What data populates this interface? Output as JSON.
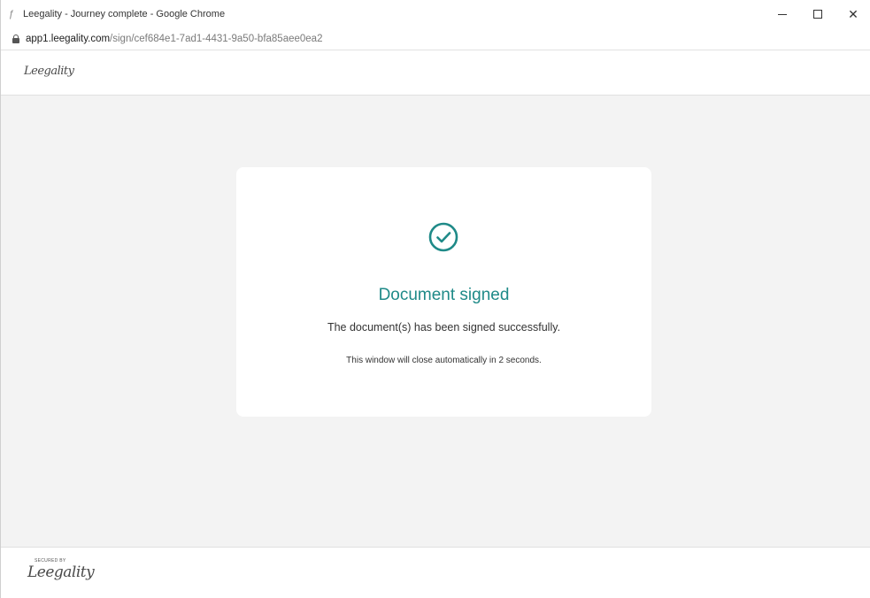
{
  "window": {
    "title": "Leegality - Journey complete - Google Chrome"
  },
  "address_bar": {
    "host": "app1.leegality.com",
    "path": "/sign/cef684e1-7ad1-4431-9a50-bfa85aee0ea2"
  },
  "header": {
    "logo_text": "Leegality"
  },
  "card": {
    "icon": "check-circle-icon",
    "title": "Document signed",
    "message": "The document(s) has been signed successfully.",
    "note": "This window will close automatically in 2 seconds."
  },
  "footer": {
    "secured_by": "SECURED BY",
    "logo_text": "Leegality"
  },
  "colors": {
    "accent": "#1f8a88",
    "background": "#f3f3f3",
    "card": "#ffffff"
  }
}
